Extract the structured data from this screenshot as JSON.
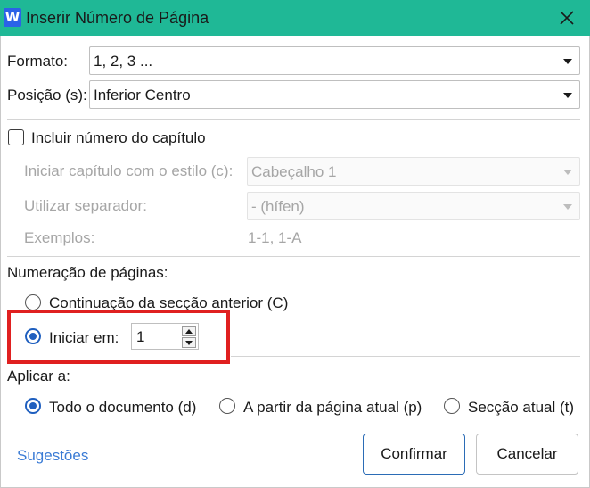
{
  "window": {
    "title": "Inserir Número de Página",
    "app_icon_letter": "W",
    "app_icon_color": "#2b62e8",
    "titlebar_color": "#1fb896"
  },
  "format": {
    "label": "Formato:",
    "value": "1, 2, 3 ..."
  },
  "position": {
    "label": "Posição (s):",
    "value": "Inferior Centro"
  },
  "chapter": {
    "include_label": "Incluir número do capítulo",
    "include_checked": false,
    "style_label": "Iniciar capítulo com o estilo (c):",
    "style_value": "Cabeçalho 1",
    "separator_label": "Utilizar separador:",
    "separator_value": "- (hífen)",
    "examples_label": "Exemplos:",
    "examples_value": "1-1, 1-A"
  },
  "page_numbering": {
    "heading": "Numeração de páginas:",
    "continue_label": "Continuação da secção anterior (C)",
    "start_label": "Iniciar em:",
    "start_value": "1",
    "selected": "start"
  },
  "apply_to": {
    "heading": "Aplicar a:",
    "options": [
      "Todo o documento (d)",
      "A partir da página atual (p)",
      "Secção atual (t)"
    ],
    "selected_index": 0
  },
  "footer": {
    "suggestions_label": "Sugestões",
    "confirm_label": "Confirmar",
    "cancel_label": "Cancelar"
  },
  "colors": {
    "accent": "#1f5fbf",
    "highlight_box": "#e02020",
    "link": "#3a7bd5"
  }
}
